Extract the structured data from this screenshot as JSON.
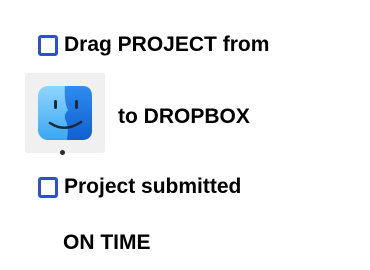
{
  "task_list": {
    "item1_label": "Drag PROJECT from",
    "item1_suffix": "to DROPBOX",
    "item2_label": "Project submitted",
    "item2_suffix": "ON TIME"
  },
  "colors": {
    "checkbox_border": "#2c4fd6",
    "finder_light": "#6ec6f5",
    "finder_dark": "#1a6fe0"
  },
  "icons": {
    "finder": "finder-icon",
    "checkbox": "checkbox-icon"
  }
}
